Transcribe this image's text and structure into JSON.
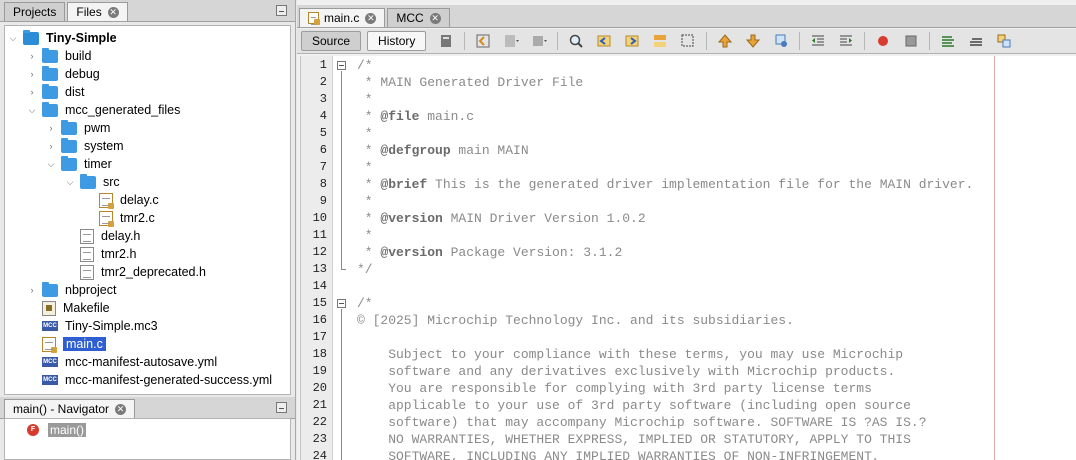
{
  "left_tabs": [
    {
      "label": "Projects",
      "active": false,
      "closable": false
    },
    {
      "label": "Files",
      "active": true,
      "closable": true
    }
  ],
  "tree": [
    {
      "label": "Tiny-Simple",
      "depth": 0,
      "arrow": "open",
      "icon": "folder-big",
      "bold": true
    },
    {
      "label": "build",
      "depth": 1,
      "arrow": "closed",
      "icon": "folder"
    },
    {
      "label": "debug",
      "depth": 1,
      "arrow": "closed",
      "icon": "folder"
    },
    {
      "label": "dist",
      "depth": 1,
      "arrow": "closed",
      "icon": "folder"
    },
    {
      "label": "mcc_generated_files",
      "depth": 1,
      "arrow": "open",
      "icon": "folder"
    },
    {
      "label": "pwm",
      "depth": 2,
      "arrow": "closed",
      "icon": "folder"
    },
    {
      "label": "system",
      "depth": 2,
      "arrow": "closed",
      "icon": "folder"
    },
    {
      "label": "timer",
      "depth": 2,
      "arrow": "open",
      "icon": "folder"
    },
    {
      "label": "src",
      "depth": 3,
      "arrow": "open",
      "icon": "folder"
    },
    {
      "label": "delay.c",
      "depth": 4,
      "arrow": "none",
      "icon": "c-file"
    },
    {
      "label": "tmr2.c",
      "depth": 4,
      "arrow": "none",
      "icon": "c-file"
    },
    {
      "label": "delay.h",
      "depth": 3,
      "arrow": "none",
      "icon": "h-file"
    },
    {
      "label": "tmr2.h",
      "depth": 3,
      "arrow": "none",
      "icon": "h-file"
    },
    {
      "label": "tmr2_deprecated.h",
      "depth": 3,
      "arrow": "none",
      "icon": "h-file"
    },
    {
      "label": "nbproject",
      "depth": 1,
      "arrow": "closed",
      "icon": "folder"
    },
    {
      "label": "Makefile",
      "depth": 1,
      "arrow": "none",
      "icon": "makefile"
    },
    {
      "label": "Tiny-Simple.mc3",
      "depth": 1,
      "arrow": "none",
      "icon": "mcc"
    },
    {
      "label": "main.c",
      "depth": 1,
      "arrow": "none",
      "icon": "c-file",
      "selected": true
    },
    {
      "label": "mcc-manifest-autosave.yml",
      "depth": 1,
      "arrow": "none",
      "icon": "mcc"
    },
    {
      "label": "mcc-manifest-generated-success.yml",
      "depth": 1,
      "arrow": "none",
      "icon": "mcc"
    }
  ],
  "mcc_icon_text": "MCC",
  "navigator": {
    "tab_label": "main() - Navigator",
    "item": "main()",
    "item_icon": "F"
  },
  "editor_tabs": [
    {
      "label": "main.c",
      "active": true
    },
    {
      "label": "MCC",
      "active": false
    }
  ],
  "toolbar": {
    "source_label": "Source",
    "history_label": "History"
  },
  "line_numbers": [
    "1",
    "2",
    "3",
    "4",
    "5",
    "6",
    "7",
    "8",
    "9",
    "10",
    "11",
    "12",
    "13",
    "14",
    "15",
    "16",
    "17",
    "18",
    "19",
    "20",
    "21",
    "22",
    "23",
    "24"
  ],
  "code_lines": [
    {
      "pre": "/*",
      "tag": "",
      "post": ""
    },
    {
      "pre": " * MAIN Generated Driver File",
      "tag": "",
      "post": ""
    },
    {
      "pre": " *",
      "tag": "",
      "post": ""
    },
    {
      "pre": " * ",
      "tag": "@file",
      "post": " main.c"
    },
    {
      "pre": " *",
      "tag": "",
      "post": ""
    },
    {
      "pre": " * ",
      "tag": "@defgroup",
      "post": " main MAIN"
    },
    {
      "pre": " *",
      "tag": "",
      "post": ""
    },
    {
      "pre": " * ",
      "tag": "@brief",
      "post": " This is the generated driver implementation file for the MAIN driver."
    },
    {
      "pre": " *",
      "tag": "",
      "post": ""
    },
    {
      "pre": " * ",
      "tag": "@version",
      "post": " MAIN Driver Version 1.0.2"
    },
    {
      "pre": " *",
      "tag": "",
      "post": ""
    },
    {
      "pre": " * ",
      "tag": "@version",
      "post": " Package Version: 3.1.2"
    },
    {
      "pre": "*/",
      "tag": "",
      "post": ""
    },
    {
      "pre": "",
      "tag": "",
      "post": ""
    },
    {
      "pre": "/*",
      "tag": "",
      "post": ""
    },
    {
      "pre": "© [2025] Microchip Technology Inc. and its subsidiaries.",
      "tag": "",
      "post": ""
    },
    {
      "pre": "",
      "tag": "",
      "post": ""
    },
    {
      "pre": "    Subject to your compliance with these terms, you may use Microchip",
      "tag": "",
      "post": ""
    },
    {
      "pre": "    software and any derivatives exclusively with Microchip products.",
      "tag": "",
      "post": ""
    },
    {
      "pre": "    You are responsible for complying with 3rd party license terms",
      "tag": "",
      "post": ""
    },
    {
      "pre": "    applicable to your use of 3rd party software (including open source",
      "tag": "",
      "post": ""
    },
    {
      "pre": "    software) that may accompany Microchip software. SOFTWARE IS ?AS IS.?",
      "tag": "",
      "post": ""
    },
    {
      "pre": "    NO WARRANTIES, WHETHER EXPRESS, IMPLIED OR STATUTORY, APPLY TO THIS",
      "tag": "",
      "post": ""
    },
    {
      "pre": "    SOFTWARE, INCLUDING ANY IMPLIED WARRANTIES OF NON-INFRINGEMENT,",
      "tag": "",
      "post": ""
    }
  ]
}
